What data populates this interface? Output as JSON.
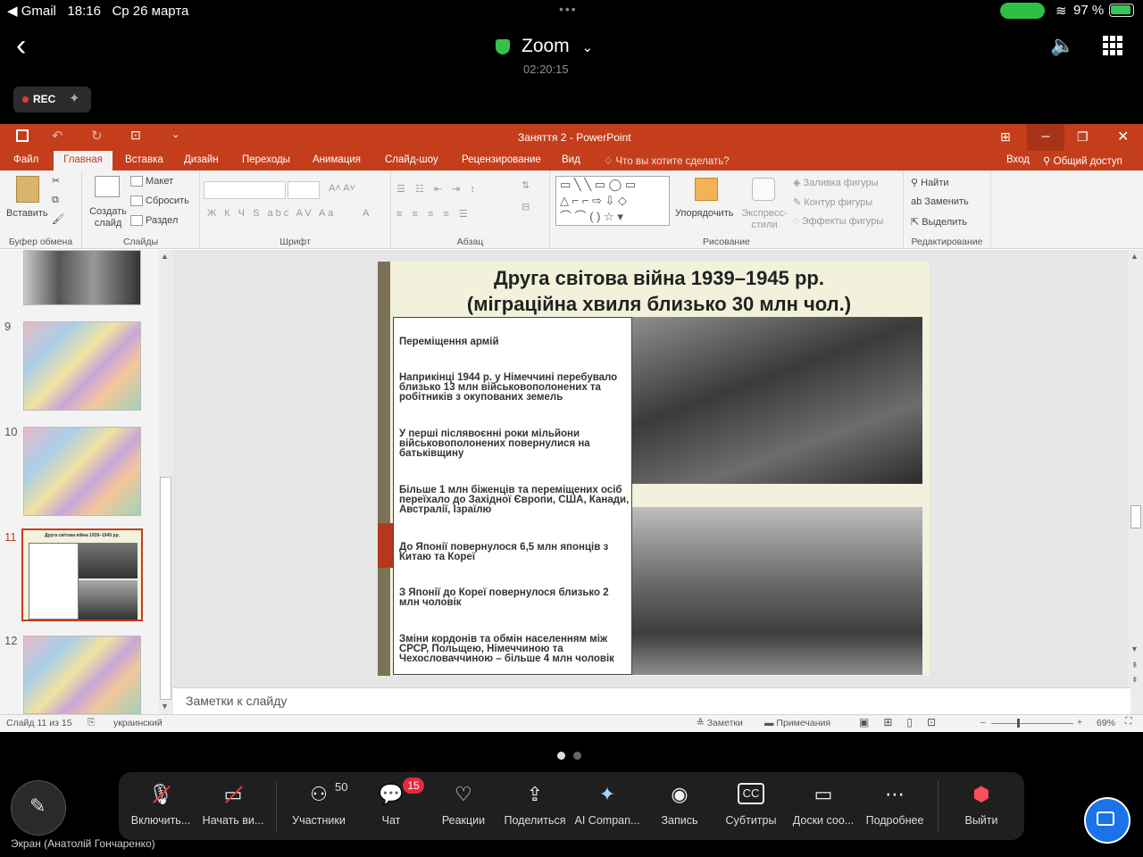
{
  "status": {
    "carrier": "◀ Gmail",
    "time": "18:16",
    "date": "Ср 26 марта",
    "battery": "97 %"
  },
  "zoom": {
    "title": "Zoom",
    "timer": "02:20:15",
    "rec": "REC"
  },
  "ppt": {
    "window_title": "Заняття 2 - PowerPoint",
    "tabs": [
      "Файл",
      "Главная",
      "Вставка",
      "Дизайн",
      "Переходы",
      "Анимация",
      "Слайд-шоу",
      "Рецензирование",
      "Вид",
      "Что вы хотите сделать?"
    ],
    "signin": "Вход",
    "share": "Общий доступ",
    "ribbon": {
      "paste": "Вставить",
      "clipboard": "Буфер обмена",
      "new_slide": "Создать слайд",
      "layout": "Макет",
      "reset": "Сбросить",
      "section": "Раздел",
      "slides": "Слайды",
      "font_group": "Шрифт",
      "paragraph": "Абзац",
      "arrange": "Упорядочить",
      "quick_styles": "Экспресс-стили",
      "fill": "Заливка фигуры",
      "outline": "Контур фигуры",
      "effects": "Эффекты фигуры",
      "drawing": "Рисование",
      "find": "Найти",
      "replace": "Заменить",
      "select": "Выделить",
      "editing": "Редактирование"
    },
    "thumb_numbers": [
      "9",
      "10",
      "11",
      "12"
    ],
    "thumb11_title": "Друга світова війна 1939–1945 рр.",
    "slide": {
      "title_line1": "Друга світова війна 1939–1945 рр.",
      "title_line2": "(міграційна хвиля близько 30 млн чол.)",
      "paragraphs": [
        "Переміщення армій",
        "Наприкінці 1944 р. у Німеччині перебувало близько 13 млн військовополонених та робітників з окупованих земель",
        "У перші післявоєнні роки мільйони військовополонених повернулися на батьківщину",
        "Більше 1 млн біженців та переміщених осіб переїхало до Західної Європи, США, Канади, Австралії, Ізраїлю",
        "До Японії повернулося 6,5 млн японців з Китаю та Кореї",
        "З Японії до Кореї повернулося близько 2 млн чоловік",
        "Зміни кордонів та обмін населенням між СРСР, Польщею, Німеччиною та Чехословаччиною – більше 4 млн чоловік"
      ]
    },
    "notes_placeholder": "Заметки к слайду",
    "statusline": {
      "slide": "Слайд 11 из 15",
      "lang": "украинский",
      "notes": "Заметки",
      "comments": "Примечания",
      "zoom": "69%"
    }
  },
  "zoom_toolbar": {
    "items": [
      {
        "label": "Включить...",
        "icon": "mic-muted-icon"
      },
      {
        "label": "Начать ви...",
        "icon": "camera-off-icon"
      },
      {
        "label": "Участники",
        "icon": "participants-icon",
        "badge": "50"
      },
      {
        "label": "Чат",
        "icon": "chat-icon",
        "badge": "15"
      },
      {
        "label": "Реакции",
        "icon": "heart-icon"
      },
      {
        "label": "Поделиться",
        "icon": "share-icon"
      },
      {
        "label": "AI Compan...",
        "icon": "sparkle-icon"
      },
      {
        "label": "Запись",
        "icon": "record-icon"
      },
      {
        "label": "Субтитры",
        "icon": "cc-icon"
      },
      {
        "label": "Доски соо...",
        "icon": "whiteboard-icon"
      },
      {
        "label": "Подробнее",
        "icon": "more-icon"
      },
      {
        "label": "Выйти",
        "icon": "leave-icon"
      }
    ]
  },
  "screen_label": "Экран (Анатолій Гончаренко)"
}
